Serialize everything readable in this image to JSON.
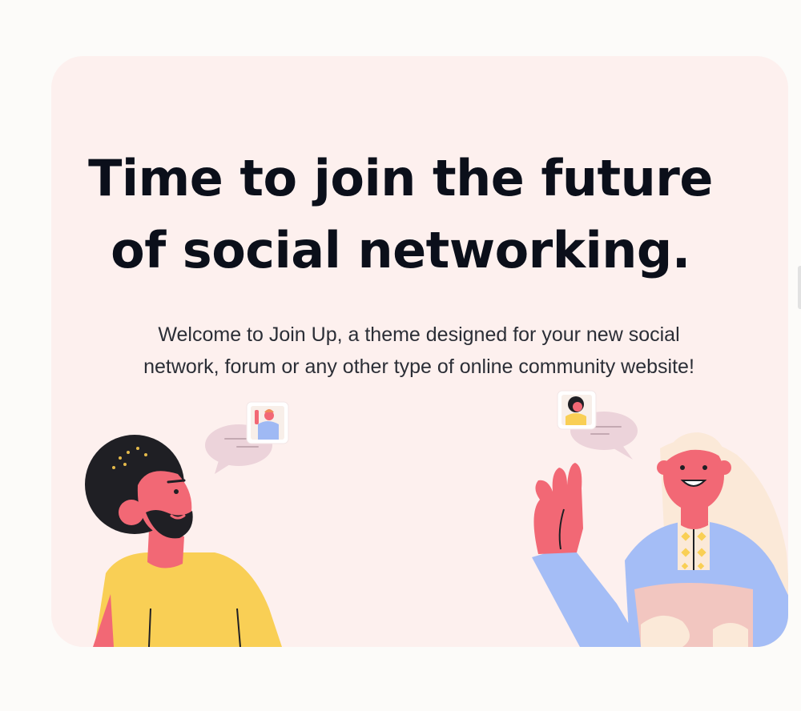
{
  "hero": {
    "headline_line1": "Time to join the future",
    "headline_line2": "of social networking.",
    "subtitle_line1": "Welcome to Join Up, a theme designed for your new social",
    "subtitle_line2": "network, forum or any other type of online community website!"
  },
  "illustration": {
    "left_person": "bearded-man-yellow-shirt",
    "right_person": "woman-waving-blue-shirt",
    "left_chat": "speech-bubble-icon",
    "right_chat": "speech-bubble-icon"
  },
  "colors": {
    "page_background": "#fcfbf9",
    "card_background": "#fdf0ee",
    "headline": "#0b0f1a",
    "skin": "#f26875",
    "hair_dark": "#1f1f24",
    "shirt_yellow": "#f9cf55",
    "shirt_blue": "#a4bdf6",
    "hair_blonde": "#fbe9d8"
  }
}
